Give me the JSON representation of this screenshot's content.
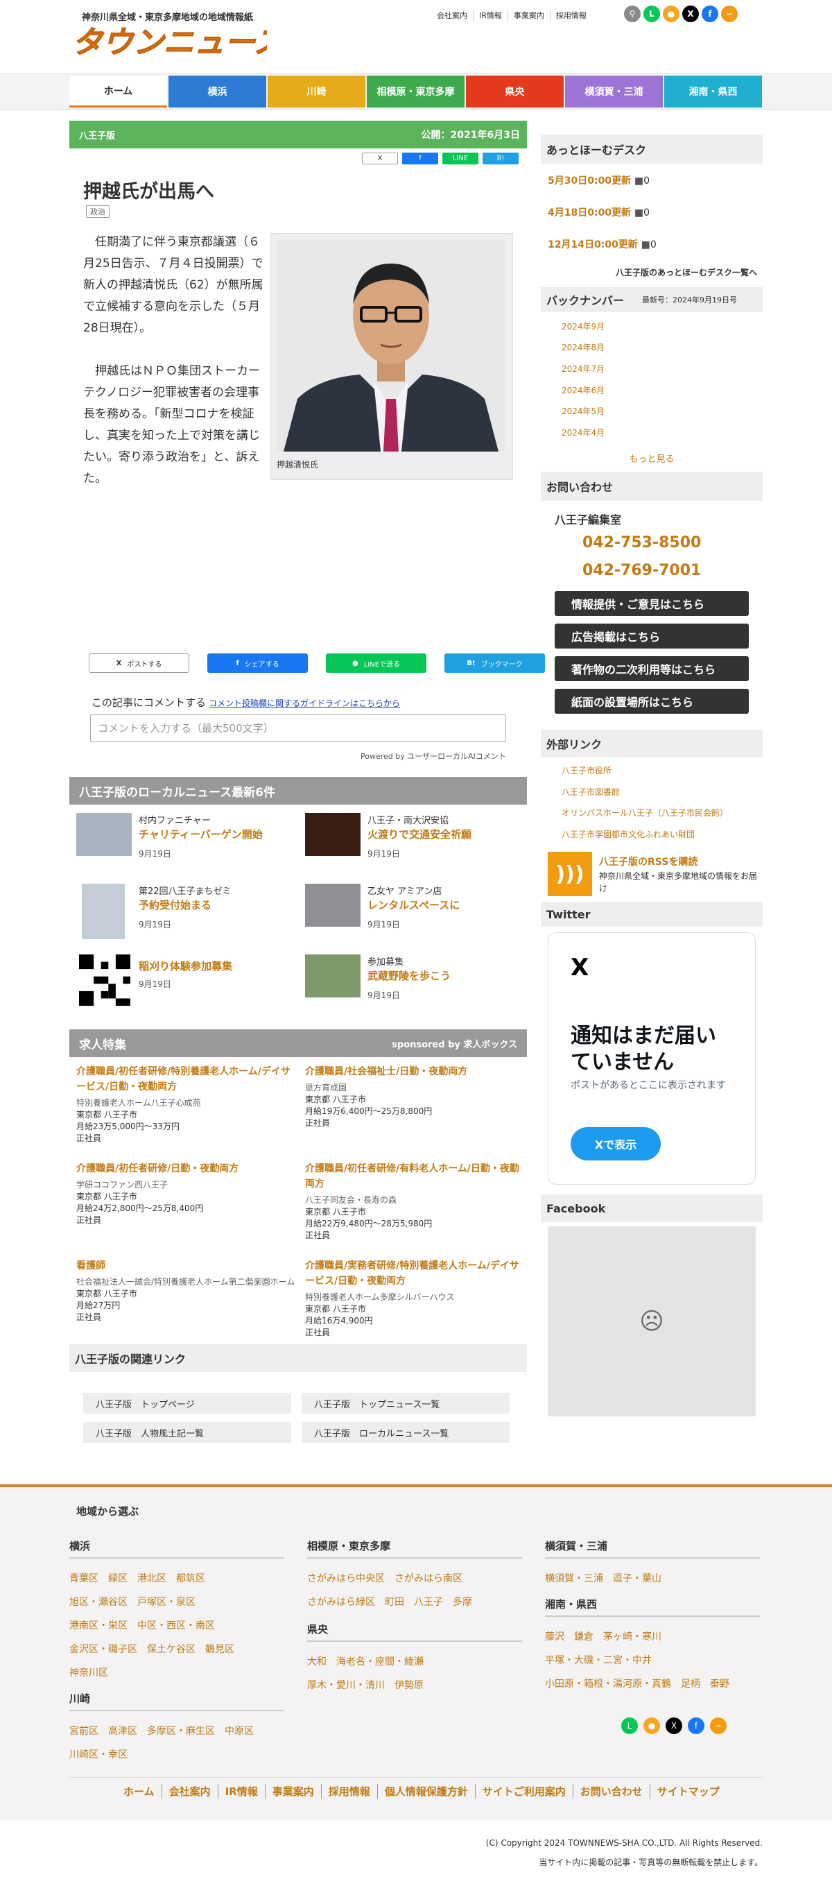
{
  "header": {
    "tagline": "神奈川県全域・東京多摩地域の地域情報紙",
    "logo_text": "タウンニュース",
    "links": [
      "会社案内",
      "IR情報",
      "事業案内",
      "採用情報"
    ],
    "sns_icons": [
      "search-icon",
      "line-icon",
      "chat-icon",
      "x-icon",
      "facebook-icon",
      "rss-icon"
    ]
  },
  "nav": [
    {
      "label": "ホーム",
      "color": "#ffffff"
    },
    {
      "label": "横浜",
      "color": "#2e7bd6"
    },
    {
      "label": "川崎",
      "color": "#e6ab19"
    },
    {
      "label": "相模原・東京多摩",
      "color": "#3ea94d"
    },
    {
      "label": "県央",
      "color": "#e33a1e"
    },
    {
      "label": "横須賀・三浦",
      "color": "#9b74d6"
    },
    {
      "label": "湘南・県西",
      "color": "#1fb0d1"
    }
  ],
  "article": {
    "edition": "八王子版",
    "published": "公開：2021年6月3日",
    "share_top": [
      "X",
      "f",
      "LINE",
      "B!"
    ],
    "title": "押越氏が出馬へ",
    "genre": "政治",
    "para1": "任期満了に伴う東京都議選（６月25日告示、７月４日投開票）で新人の押越清悦氏（62）が無所属で立候補する意向を示した（５月28日現在）。",
    "para2": "押越氏はＮＰＯ集団ストーカーテクノロジー犯罪被害者の会理事長を務める。「新型コロナを検証し、真実を知った上で対策を講じたい。寄り添う政治を」と、訴えた。",
    "photo_caption": "押越清悦氏",
    "share_buttons": [
      "ポストする",
      "シェアする",
      "LINEで送る",
      "ブックマーク"
    ],
    "comment_label": "この記事にコメントする",
    "comment_guide": "コメント投稿欄に関するガイドラインはこちらから",
    "comment_placeholder": "コメントを入力する（最大500文字）",
    "powered_by": "Powered by ユーザーローカルAIコメント"
  },
  "local_news": {
    "heading": "八王子版のローカルニュース最新6件",
    "items": [
      {
        "source": "村内ファニチャー",
        "title": "チャリティーバーゲン開始",
        "date": "9月19日"
      },
      {
        "source": "八王子・南大沢安協",
        "title": "火渡りで交通安全祈願",
        "date": "9月19日"
      },
      {
        "source": "第22回八王子まちゼミ",
        "title": "予約受付始まる",
        "date": "9月19日"
      },
      {
        "source": "乙女ヤ アミアン店",
        "title": "レンタルスペースに",
        "date": "9月19日"
      },
      {
        "source": "",
        "title": "稲刈り体験参加募集",
        "date": "9月19日"
      },
      {
        "source": "参加募集",
        "title": "武蔵野陵を歩こう",
        "date": "9月19日"
      }
    ]
  },
  "jobs": {
    "heading": "求人特集",
    "sponsor": "sponsored by 求人ボックス",
    "items": [
      {
        "title": "介護職員/初任者研修/特別養護老人ホーム/デイサービス/日勤・夜勤両方",
        "company": "特別養護老人ホーム八王子心成苑",
        "location": "東京都 八王子市",
        "salary": "月給23万5,000円〜33万円",
        "type": "正社員"
      },
      {
        "title": "介護職員/社会福祉士/日勤・夜勤両方",
        "company": "恩方育成園",
        "location": "東京都 八王子市",
        "salary": "月給19万6,400円〜25万8,800円",
        "type": "正社員"
      },
      {
        "title": "介護職員/初任者研修/日勤・夜勤両方",
        "company": "学研ココファン西八王子",
        "location": "東京都 八王子市",
        "salary": "月給24万2,800円〜25万8,400円",
        "type": "正社員"
      },
      {
        "title": "介護職員/初任者研修/有料老人ホーム/日勤・夜勤両方",
        "company": "八王子同友会・長寿の森",
        "location": "東京都 八王子市",
        "salary": "月給22万9,480円〜28万5,980円",
        "type": "正社員"
      },
      {
        "title": "看護師",
        "company": "社会福祉法人一誠会/特別養護老人ホーム第二偕楽園ホーム",
        "location": "東京都 八王子市",
        "salary": "月給27万円",
        "type": "正社員"
      },
      {
        "title": "介護職員/実務者研修/特別養護老人ホーム/デイサービス/日勤・夜勤両方",
        "company": "特別養護老人ホーム多摩シルバーハウス",
        "location": "東京都 八王子市",
        "salary": "月給16万4,900円",
        "type": "正社員"
      }
    ]
  },
  "related": {
    "heading": "八王子版の関連リンク",
    "links": [
      "八王子版　トップページ",
      "八王子版　トップニュース一覧",
      "八王子版　人物風土記一覧",
      "八王子版　ローカルニュース一覧"
    ]
  },
  "sidebar": {
    "desk_heading": "あっとほーむデスク",
    "desk_items": [
      {
        "label": "5月30日0:00更新",
        "count": "0"
      },
      {
        "label": "4月18日0:00更新",
        "count": "0"
      },
      {
        "label": "12月14日0:00更新",
        "count": "0"
      }
    ],
    "desk_more": "八王子版のあっとほーむデスク一覧へ",
    "backnumber_heading": "バックナンバー",
    "backnumber_latest": "最新号：2024年9月19日号",
    "backnumbers": [
      "2024年9月",
      "2024年8月",
      "2024年7月",
      "2024年6月",
      "2024年5月",
      "2024年4月"
    ],
    "more": "もっと見る",
    "contact_heading": "お問い合わせ",
    "office": "八王子編集室",
    "phone1": "042-753-8500",
    "phone2": "042-769-7001",
    "buttons": [
      "情報提供・ご意見はこちら",
      "広告掲載はこちら",
      "著作物の二次利用等はこちら",
      "紙面の設置場所はこちら"
    ],
    "ext_heading": "外部リンク",
    "ext_links": [
      "八王子市役所",
      "八王子市図書館",
      "オリンパスホール八王子（八王子市民会館）",
      "八王子市学園都市文化ふれあい財団"
    ],
    "rss_title": "八王子版のRSSを購読",
    "rss_desc": "神奈川県全域・東京多摩地域の情報をお届け",
    "twitter_heading": "Twitter",
    "twitter_msg": "通知はまだ届いていません",
    "twitter_sub": "ポストがあるとここに表示されます",
    "twitter_btn": "Xで表示",
    "facebook_heading": "Facebook"
  },
  "footer": {
    "heading": "地域から選ぶ",
    "yokohama": {
      "title": "横浜",
      "rows": [
        "青葉区　緑区　港北区　都筑区",
        "旭区・瀬谷区　戸塚区・泉区",
        "港南区・栄区　中区・西区・南区",
        "金沢区・磯子区　保土ケ谷区　鶴見区",
        "神奈川区"
      ]
    },
    "kawasaki": {
      "title": "川崎",
      "rows": [
        "宮前区　高津区　多摩区・麻生区　中原区",
        "川崎区・幸区"
      ]
    },
    "sagamihara": {
      "title": "相模原・東京多摩",
      "rows": [
        "さがみはら中央区　さがみはら南区",
        "さがみはら緑区　町田　八王子　多摩"
      ]
    },
    "kenou": {
      "title": "県央",
      "rows": [
        "大和　海老名・座間・綾瀬",
        "厚木・愛川・清川　伊勢原"
      ]
    },
    "yokosuka": {
      "title": "横須賀・三浦",
      "rows": [
        "横須賀・三浦　逗子・葉山"
      ]
    },
    "shonan": {
      "title": "湘南・県西",
      "rows": [
        "藤沢　鎌倉　茅ヶ崎・寒川",
        "平塚・大磯・二宮・中井",
        "小田原・箱根・湯河原・真鶴　足柄　秦野"
      ]
    },
    "links": [
      "ホーム",
      "会社案内",
      "IR情報",
      "事業案内",
      "採用情報",
      "個人情報保護方針",
      "サイトご利用案内",
      "お問い合わせ",
      "サイトマップ"
    ],
    "copyright": "(C) Copyright 2024 TOWNNEWS-SHA CO.,LTD. All Rights Reserved.",
    "notice": "当サイト内に掲載の記事・写真等の無断転載を禁止します。"
  },
  "colors": {
    "accent": "#e87b1c",
    "link": "#c27b14",
    "edition_bar": "#5bb35b"
  }
}
